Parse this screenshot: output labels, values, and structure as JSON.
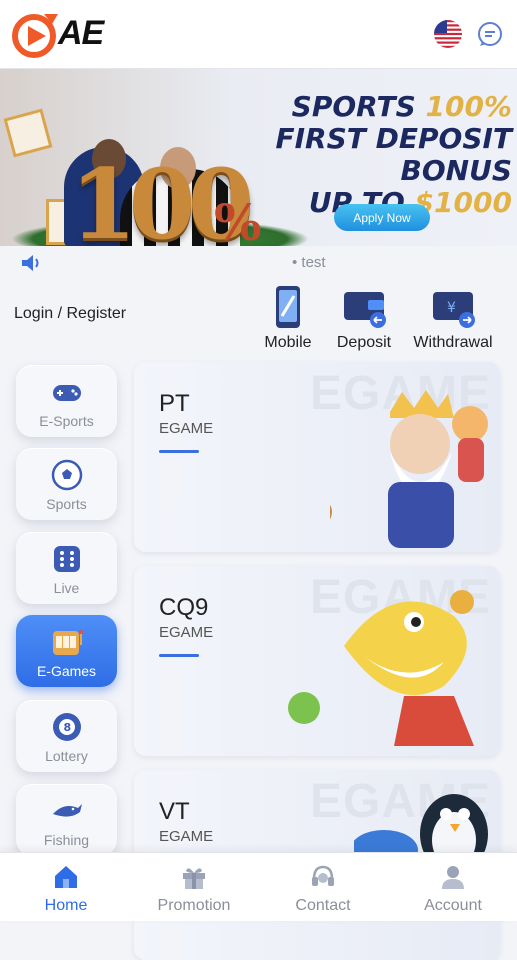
{
  "header": {
    "logo_text": "AE",
    "language_icon": "us-flag-icon",
    "chat_icon": "chat-bubble-icon"
  },
  "banner": {
    "line1": "SPORTS",
    "line1_highlight": "100%",
    "line2": "FIRST DEPOSIT BONUS",
    "line3": "UP TO",
    "line3_highlight": "$1000",
    "big_number": "100",
    "big_percent": "%",
    "button": "Apply Now"
  },
  "notice": {
    "text": "test"
  },
  "account": {
    "login_label": "Login / Register",
    "quick_actions": [
      {
        "label": "Mobile",
        "icon": "mobile-phone-icon"
      },
      {
        "label": "Deposit",
        "icon": "wallet-deposit-icon"
      },
      {
        "label": "Withdrawal",
        "icon": "wallet-withdrawal-icon"
      }
    ]
  },
  "sidebar": {
    "items": [
      {
        "label": "E-Sports",
        "icon": "gamepad-icon",
        "active": false
      },
      {
        "label": "Sports",
        "icon": "soccer-ball-icon",
        "active": false
      },
      {
        "label": "Live",
        "icon": "dice-icon",
        "active": false
      },
      {
        "label": "E-Games",
        "icon": "slot-machine-icon",
        "active": true
      },
      {
        "label": "Lottery",
        "icon": "lottery-ball-icon",
        "active": false
      },
      {
        "label": "Fishing",
        "icon": "shark-icon",
        "active": false
      }
    ]
  },
  "games": [
    {
      "title": "PT",
      "subtitle": "EGAME",
      "watermark": "EGAME"
    },
    {
      "title": "CQ9",
      "subtitle": "EGAME",
      "watermark": "EGAME"
    },
    {
      "title": "VT",
      "subtitle": "EGAME",
      "watermark": "EGAME"
    }
  ],
  "bottom_nav": {
    "tabs": [
      {
        "label": "Home",
        "icon": "home-icon",
        "active": true
      },
      {
        "label": "Promotion",
        "icon": "gift-icon",
        "active": false
      },
      {
        "label": "Contact",
        "icon": "headset-icon",
        "active": false
      },
      {
        "label": "Account",
        "icon": "user-icon",
        "active": false
      }
    ]
  },
  "colors": {
    "accent": "#2f6de6",
    "brand_orange": "#f05a28"
  }
}
